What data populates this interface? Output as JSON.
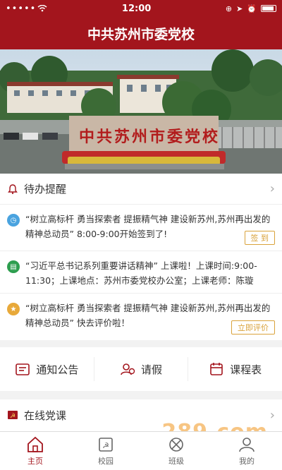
{
  "status": {
    "time": "12:00",
    "signal": "•••••"
  },
  "header": {
    "title": "中共苏州市委党校"
  },
  "banner": {
    "stone_text": "中共苏州市委党校"
  },
  "todo": {
    "title": "待办提醒",
    "items": [
      {
        "text": "“树立高标杆 勇当探索者 提振精气神 建设新苏州,苏州再出发的精神总动员” 8:00-9:00开始签到了!",
        "action": "签 到",
        "icon_color": "#4aa3df",
        "icon": "clock-icon"
      },
      {
        "text": "“习近平总书记系列重要讲话精神” 上课啦！上课时间:9:00-11:30；上课地点：苏州市委党校办公室；上课老师：陈璇",
        "action": "",
        "icon_color": "#2e9e4f",
        "icon": "book-icon"
      },
      {
        "text": "“树立高标杆 勇当探索者 提振精气神 建设新苏州,苏州再出发的精神总动员” 快去评价啦！",
        "action": "立即评价",
        "icon_color": "#e8a93a",
        "icon": "star-icon"
      }
    ]
  },
  "quick": {
    "notice": "通知公告",
    "leave": "请假",
    "schedule": "课程表"
  },
  "online": {
    "title": "在线党课"
  },
  "tabs": {
    "home": "主页",
    "campus": "校园",
    "class": "班级",
    "mine": "我的"
  },
  "watermark": "289.com",
  "colors": {
    "brand": "#a3151d",
    "accent": "#d9a23b"
  }
}
